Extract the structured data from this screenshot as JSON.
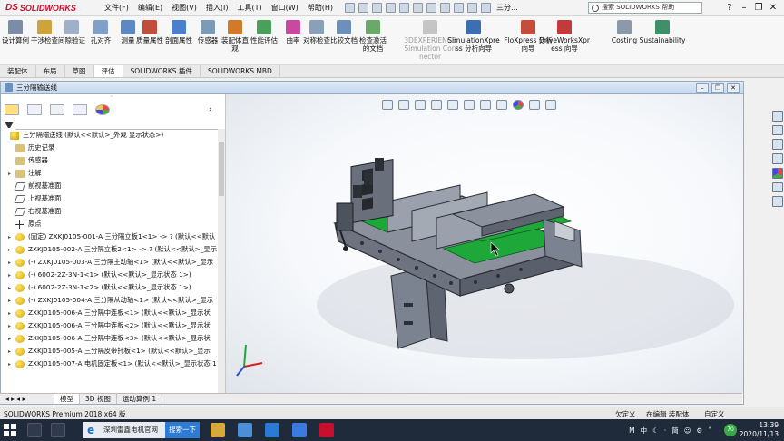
{
  "app": {
    "logo_ds": "DS",
    "logo_text": "SOLIDWORKS",
    "doc_title": "三分...",
    "search_placeholder": "搜索 SOLIDWORKS 帮助"
  },
  "menus": [
    "文件(F)",
    "编辑(E)",
    "视图(V)",
    "插入(I)",
    "工具(T)",
    "窗口(W)",
    "帮助(H)"
  ],
  "ribbon": {
    "buttons": [
      {
        "label": "设计算例",
        "color": "#7a8ca8"
      },
      {
        "label": "干涉检查",
        "color": "#d0a23a"
      },
      {
        "label": "间隙验证",
        "color": "#a0b0c8"
      },
      {
        "label": "孔对齐",
        "color": "#7fa0c9"
      },
      {
        "label": "测量",
        "color": "#5c88c4"
      },
      {
        "label": "质量属性",
        "color": "#c04e3a"
      },
      {
        "label": "剖面属性",
        "color": "#4a7fcd"
      },
      {
        "label": "传感器",
        "color": "#7b9bb7"
      },
      {
        "label": "装配体直观",
        "color": "#d07a2b"
      },
      {
        "label": "性能评估",
        "color": "#49a05a"
      },
      {
        "label": "曲率",
        "color": "#c84aa0"
      },
      {
        "label": "对称检查",
        "color": "#8b9fb7"
      },
      {
        "label": "比较文档",
        "color": "#6d8fb9"
      },
      {
        "label": "检查激活的文档",
        "color": "#6aa96a"
      },
      {
        "label": "3DEXPERIENCE Simulation Connector",
        "color": "#c5c5c5",
        "dim": true
      },
      {
        "label": "SimulationXpress 分析向导",
        "color": "#3b6fb2"
      },
      {
        "label": "FloXpress 分析向导",
        "color": "#c74d3b"
      },
      {
        "label": "DriveWorksXpress 向导",
        "color": "#c33a3a"
      },
      {
        "label": "Costing",
        "color": "#8a9aa8"
      },
      {
        "label": "Sustainability",
        "color": "#3e8f6a"
      }
    ]
  },
  "tabs": [
    "装配体",
    "布局",
    "草图",
    "评估",
    "SOLIDWORKS 插件",
    "SOLIDWORKS MBD"
  ],
  "active_tab": "评估",
  "docwin": {
    "title": "三分隔输送线"
  },
  "tree": [
    {
      "label": "三分隔输送线 (默认<<默认>_外观 显示状态>)",
      "icon": "asm",
      "indent": 0
    },
    {
      "label": "历史记录",
      "icon": "folder",
      "indent": 1
    },
    {
      "label": "传感器",
      "icon": "folder",
      "indent": 1
    },
    {
      "label": "注解",
      "icon": "folder",
      "indent": 1,
      "expand": true
    },
    {
      "label": "前视基准面",
      "icon": "plane",
      "indent": 1
    },
    {
      "label": "上视基准面",
      "icon": "plane",
      "indent": 1
    },
    {
      "label": "右视基准面",
      "icon": "plane",
      "indent": 1
    },
    {
      "label": "原点",
      "icon": "origin",
      "indent": 1
    },
    {
      "label": "(固定) ZXKJ0105-001-A 三分隔立板1<1> -> ? (默认<<默认",
      "icon": "part",
      "indent": 1,
      "expand": true
    },
    {
      "label": "ZXKJ0105-002-A 三分隔立板2<1> -> ? (默认<<默认>_显示",
      "icon": "part",
      "indent": 1,
      "expand": true
    },
    {
      "label": "(-) ZXKJ0105-003-A 三分隔主动轴<1> (默认<<默认>_显示",
      "icon": "part",
      "indent": 1,
      "expand": true
    },
    {
      "label": "(-) 6002-2Z-3N-1<1> (默认<<默认>_显示状态 1>)",
      "icon": "part",
      "indent": 1,
      "expand": true
    },
    {
      "label": "(-) 6002-2Z-3N-1<2> (默认<<默认>_显示状态 1>)",
      "icon": "part",
      "indent": 1,
      "expand": true
    },
    {
      "label": "(-) ZXKJ0105-004-A 三分隔从动轴<1> (默认<<默认>_显示",
      "icon": "part",
      "indent": 1,
      "expand": true
    },
    {
      "label": "ZXKJ0105-006-A 三分隔中连板<1> (默认<<默认>_显示状",
      "icon": "part",
      "indent": 1,
      "expand": true
    },
    {
      "label": "ZXKJ0105-006-A 三分隔中连板<2> (默认<<默认>_显示状",
      "icon": "part",
      "indent": 1,
      "expand": true
    },
    {
      "label": "ZXKJ0105-006-A 三分隔中连板<3> (默认<<默认>_显示状",
      "icon": "part",
      "indent": 1,
      "expand": true
    },
    {
      "label": "ZXKJ0105-005-A 三分隔皮带托板<1> (默认<<默认>_显示",
      "icon": "part",
      "indent": 1,
      "expand": true
    },
    {
      "label": "ZXKJ0105-007-A 电机固定板<1> (默认<<默认>_显示状态 1",
      "icon": "part",
      "indent": 1,
      "expand": true
    }
  ],
  "model_tabs": [
    "模型",
    "3D 视图",
    "运动算例 1"
  ],
  "status": {
    "app_version": "SOLIDWORKS Premium 2018 x64 版",
    "underdefined": "欠定义",
    "editing": "在编辑 装配体",
    "custom": "自定义"
  },
  "taskbar": {
    "search_text": "深圳雷鑫电机官网",
    "search_button": "搜索一下",
    "ime_m": "M",
    "ime_chinese": "中",
    "ime_simplified": "简",
    "badge": "70",
    "time": "13:39",
    "date": "2020/11/13"
  },
  "colors": {
    "accent_red": "#c8102e",
    "conveyor_green": "#1fa83a",
    "steel_gray": "#7c8390"
  }
}
